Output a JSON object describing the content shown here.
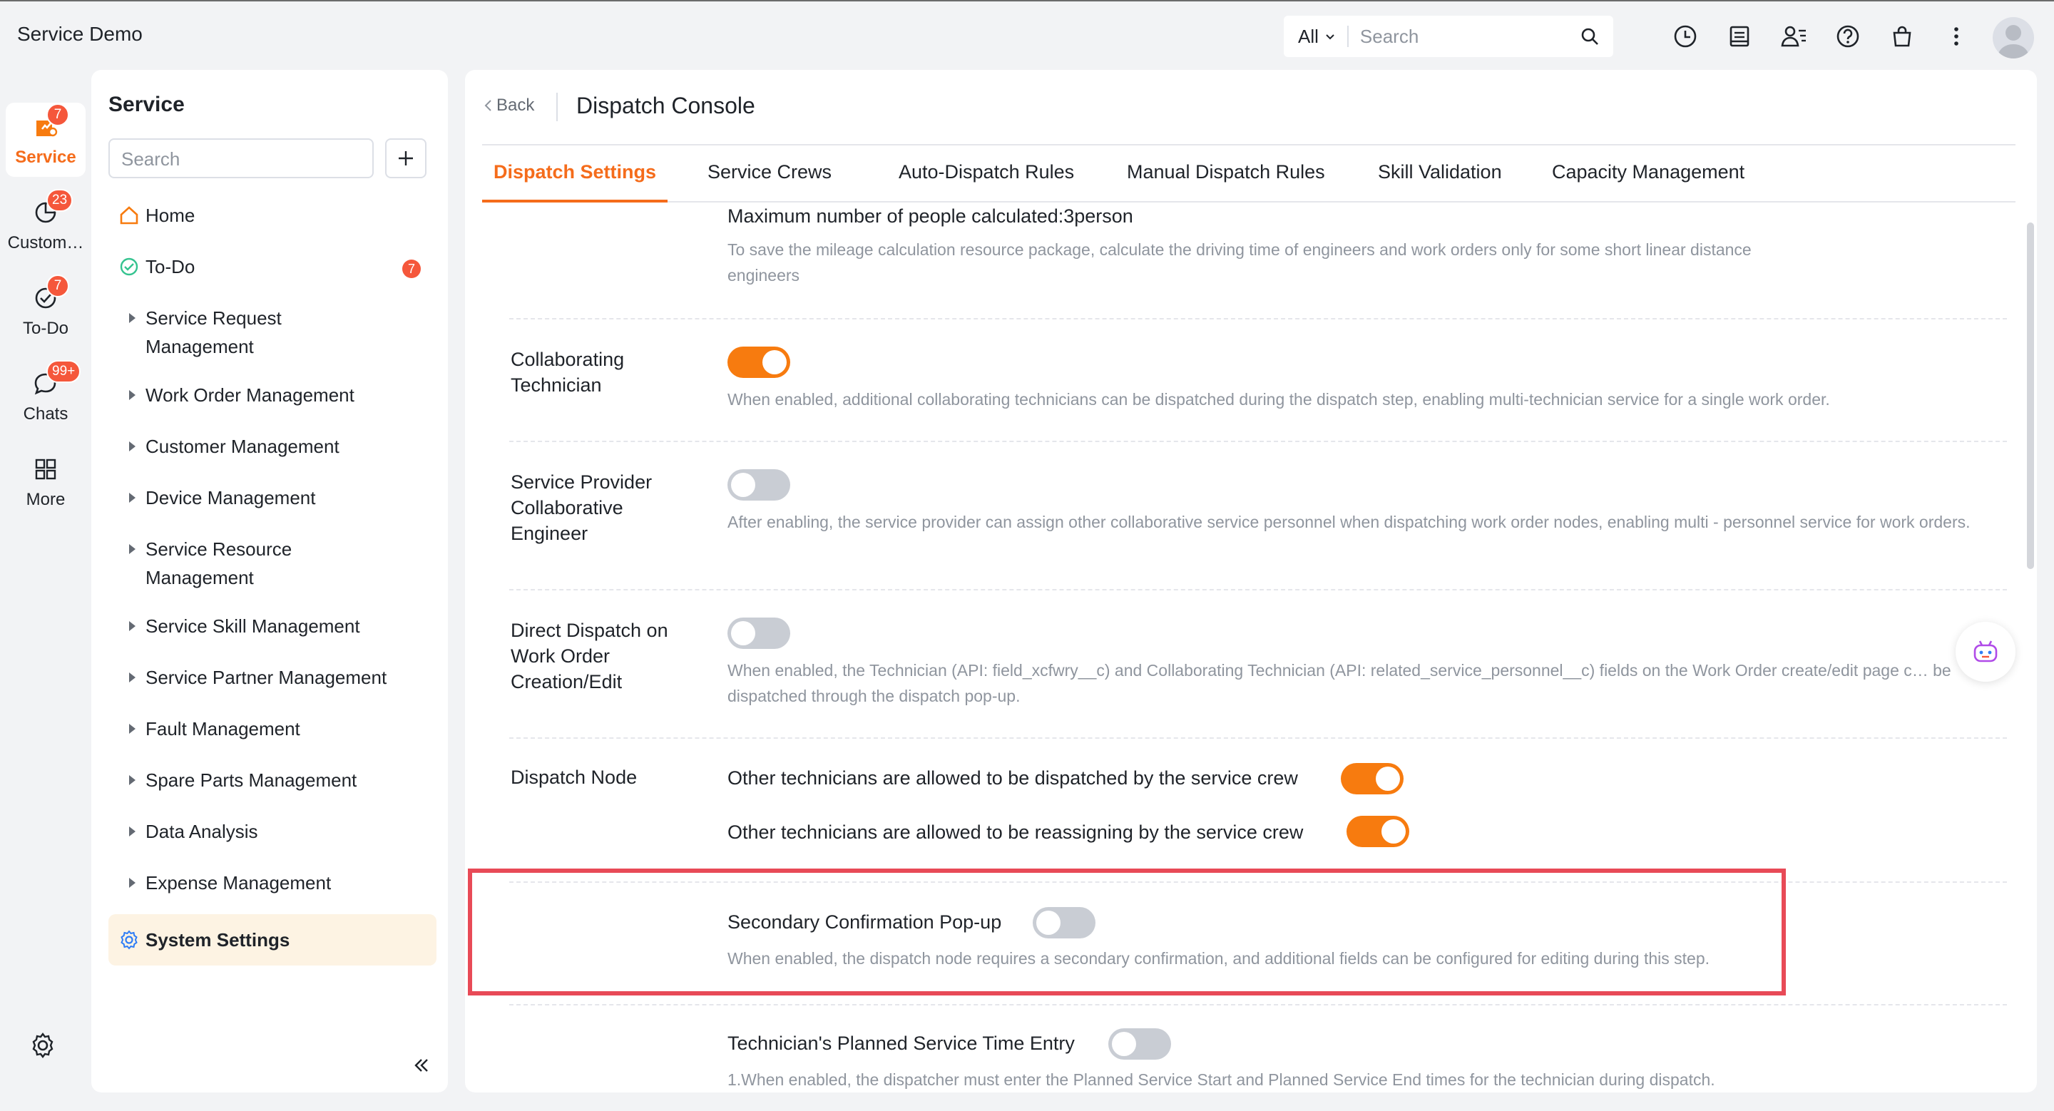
{
  "app": {
    "title": "Service Demo"
  },
  "topbar": {
    "scope": "All",
    "search_placeholder": "Search"
  },
  "rail": {
    "items": [
      {
        "label": "Service",
        "badge": "7"
      },
      {
        "label": "Custom…",
        "badge": "23"
      },
      {
        "label": "To-Do",
        "badge": "7"
      },
      {
        "label": "Chats",
        "badge": "99+"
      },
      {
        "label": "More",
        "badge": ""
      }
    ]
  },
  "side": {
    "title": "Service",
    "search_placeholder": "Search",
    "nav": [
      {
        "label": "Home"
      },
      {
        "label": "To-Do",
        "badge": "7"
      },
      {
        "label": "Service Request Management"
      },
      {
        "label": "Work Order Management"
      },
      {
        "label": "Customer Management"
      },
      {
        "label": "Device Management"
      },
      {
        "label": "Service Resource Management"
      },
      {
        "label": "Service Skill Management"
      },
      {
        "label": "Service Partner Management"
      },
      {
        "label": "Fault Management"
      },
      {
        "label": "Spare Parts Management"
      },
      {
        "label": "Data Analysis"
      },
      {
        "label": "Expense Management"
      },
      {
        "label": "System Settings"
      }
    ]
  },
  "main": {
    "back_label": "Back",
    "title": "Dispatch Console",
    "tabs": [
      {
        "label": "Dispatch Settings"
      },
      {
        "label": "Service Crews"
      },
      {
        "label": "Auto-Dispatch Rules"
      },
      {
        "label": "Manual Dispatch Rules"
      },
      {
        "label": "Skill Validation"
      },
      {
        "label": "Capacity Management"
      }
    ],
    "settings": {
      "max_people": {
        "text": "Maximum number of people calculated:3person",
        "desc": "To save the mileage calculation resource package, calculate the driving time of engineers and work orders only for some short linear distance engineers"
      },
      "collab_tech": {
        "label": "Collaborating Technician",
        "enabled": true,
        "desc": "When enabled, additional collaborating technicians can be dispatched during the dispatch step, enabling multi-technician service for a single work order."
      },
      "provider_collab": {
        "label": "Service Provider Collaborative Engineer",
        "enabled": false,
        "desc": "After enabling, the service provider can assign other collaborative service personnel when dispatching work order nodes, enabling multi - personnel service for work orders."
      },
      "direct_dispatch": {
        "label": "Direct Dispatch on Work Order Creation/Edit",
        "enabled": false,
        "desc": "When enabled, the Technician (API: field_xcfwry__c) and Collaborating Technician (API: related_service_personnel__c) fields on the Work Order create/edit page c… be dispatched through the dispatch pop-up."
      },
      "dispatch_node": {
        "label": "Dispatch Node",
        "opt1": "Other technicians are allowed to be dispatched by the service crew",
        "opt1_enabled": true,
        "opt2": "Other technicians are allowed to be reassigning by the service crew",
        "opt2_enabled": true
      },
      "secondary_confirm": {
        "text": "Secondary Confirmation Pop-up",
        "enabled": false,
        "desc": "When enabled, the dispatch node requires a secondary confirmation, and additional fields can be configured for editing during this step."
      },
      "planned_time": {
        "text": "Technician's Planned Service Time Entry",
        "enabled": false,
        "desc": "1.When enabled, the dispatcher must enter the Planned Service Start and Planned Service End times for the technician during dispatch."
      }
    }
  },
  "colors": {
    "accent": "#f77b0f",
    "highlight": "#e84a57",
    "badge": "#f5573b"
  }
}
